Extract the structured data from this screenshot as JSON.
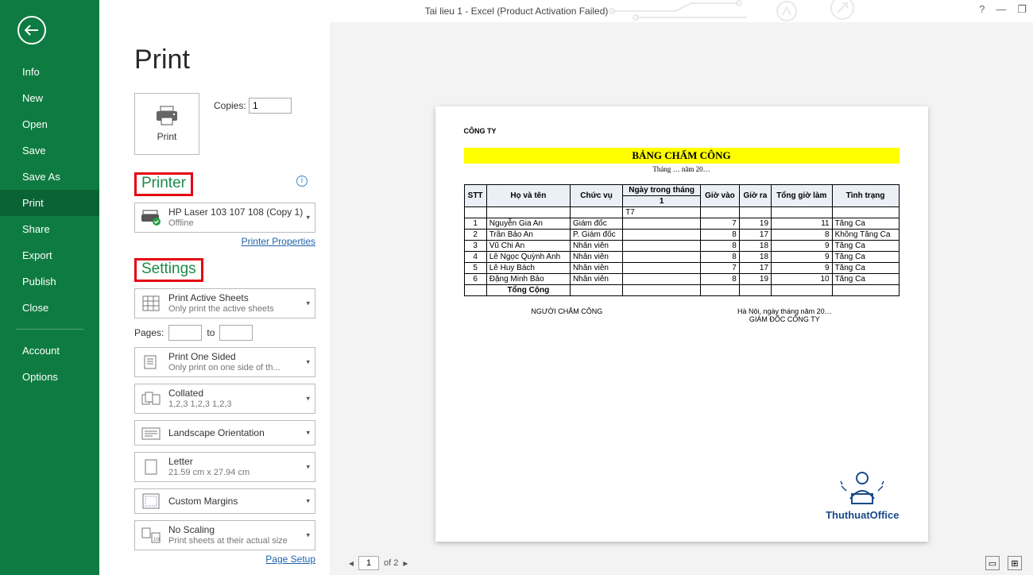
{
  "title": "Tai lieu 1 - Excel (Product Activation Failed)",
  "win": {
    "help": "?",
    "min": "—",
    "restore": "❐"
  },
  "nav": {
    "items": [
      "Info",
      "New",
      "Open",
      "Save",
      "Save As",
      "Print",
      "Share",
      "Export",
      "Publish",
      "Close"
    ],
    "selected": "Print",
    "account": "Account",
    "options": "Options"
  },
  "heading": "Print",
  "print_button": "Print",
  "copies": {
    "label": "Copies:",
    "value": "1"
  },
  "section_printer": "Printer",
  "info_icon": "i",
  "printer": {
    "name": "HP Laser 103 107 108 (Copy 1)",
    "status": "Offline"
  },
  "printer_props": "Printer Properties",
  "section_settings": "Settings",
  "setting_sheets": {
    "title": "Print Active Sheets",
    "sub": "Only print the active sheets"
  },
  "pages": {
    "label": "Pages:",
    "to": "to"
  },
  "setting_sides": {
    "title": "Print One Sided",
    "sub": "Only print on one side of th..."
  },
  "setting_collate": {
    "title": "Collated",
    "sub": "1,2,3   1,2,3   1,2,3"
  },
  "setting_orient": {
    "title": "Landscape Orientation"
  },
  "setting_size": {
    "title": "Letter",
    "sub": "21.59 cm x 27.94 cm"
  },
  "setting_margins": {
    "title": "Custom Margins"
  },
  "setting_scale": {
    "title": "No Scaling",
    "sub": "Print sheets at their actual size"
  },
  "page_setup": "Page Setup",
  "preview": {
    "company": "CÔNG TY",
    "title": "BẢNG CHẤM CÔNG",
    "subtitle": "Tháng … năm 20…",
    "headers": {
      "stt": "STT",
      "name": "Họ và tên",
      "role": "Chức vụ",
      "dayhdr": "Ngày trong tháng",
      "day": "1",
      "in": "Giờ vào",
      "out": "Giờ ra",
      "total": "Tổng giờ làm",
      "status": "Tình trạng"
    },
    "mark_row": "T7",
    "rows": [
      {
        "stt": "1",
        "name": "Nguyễn Gia An",
        "role": "Giám đốc",
        "in": "7",
        "out": "19",
        "total": "11",
        "status": "Tăng Ca"
      },
      {
        "stt": "2",
        "name": "Trần Bảo An",
        "role": "P. Giám đốc",
        "in": "8",
        "out": "17",
        "total": "8",
        "status": "Không Tăng Ca"
      },
      {
        "stt": "3",
        "name": "Vũ Chi An",
        "role": "Nhân viên",
        "in": "8",
        "out": "18",
        "total": "9",
        "status": "Tăng Ca"
      },
      {
        "stt": "4",
        "name": "Lê Ngọc Quỳnh Anh",
        "role": "Nhân viên",
        "in": "8",
        "out": "18",
        "total": "9",
        "status": "Tăng Ca"
      },
      {
        "stt": "5",
        "name": "Lê Huy Bách",
        "role": "Nhân viên",
        "in": "7",
        "out": "17",
        "total": "9",
        "status": "Tăng Ca"
      },
      {
        "stt": "6",
        "name": "Đặng Minh Bảo",
        "role": "Nhân viên",
        "in": "8",
        "out": "19",
        "total": "10",
        "status": "Tăng Ca"
      }
    ],
    "total_row": "Tổng Cộng",
    "sig_left": "NGƯỜI CHẤM CÔNG",
    "sig_right_top": "Hà Nội, ngày       tháng       năm 20…",
    "sig_right": "GIÁM ĐỐC CÔNG TY",
    "logo_text": "ThuthuatOffice"
  },
  "pager": {
    "current": "1",
    "of": "of 2"
  }
}
